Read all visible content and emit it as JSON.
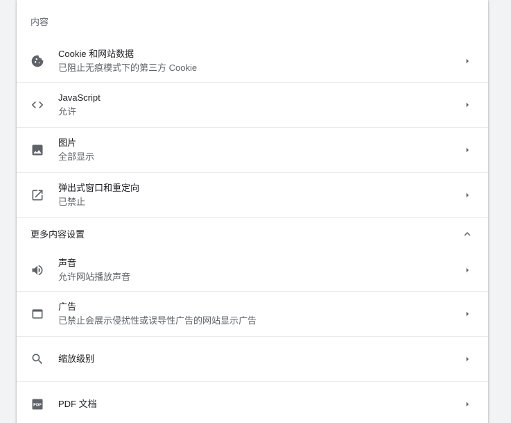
{
  "content_section": {
    "title": "内容",
    "items": [
      {
        "label": "Cookie 和网站数据",
        "sub": "已阻止无痕模式下的第三方 Cookie",
        "icon": "cookie-icon"
      },
      {
        "label": "JavaScript",
        "sub": "允许",
        "icon": "code-icon"
      },
      {
        "label": "图片",
        "sub": "全部显示",
        "icon": "image-icon"
      },
      {
        "label": "弹出式窗口和重定向",
        "sub": "已禁止",
        "icon": "open-in-new-icon"
      }
    ]
  },
  "more_section": {
    "title": "更多内容设置",
    "expanded": true,
    "items": [
      {
        "label": "声音",
        "sub": "允许网站播放声音",
        "icon": "volume-icon"
      },
      {
        "label": "广告",
        "sub": "已禁止会展示侵扰性或误导性广告的网站显示广告",
        "icon": "ads-window-icon"
      },
      {
        "label": "缩放级别",
        "icon": "search-icon"
      },
      {
        "label": "PDF 文档",
        "icon": "pdf-icon"
      }
    ]
  },
  "colors": {
    "background": "#f1f3f4",
    "card": "#ffffff",
    "divider": "#e8eaed",
    "primary_text": "#202124",
    "secondary_text": "#5f6368"
  }
}
